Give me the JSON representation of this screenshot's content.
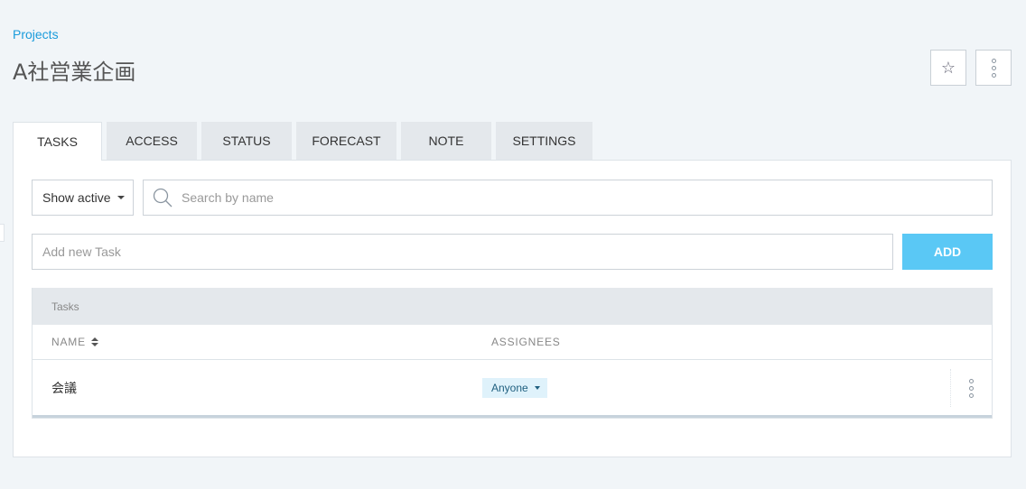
{
  "breadcrumb": {
    "label": "Projects"
  },
  "page": {
    "title": "A社営業企画"
  },
  "header_actions": {
    "star_icon": "star-icon",
    "more_icon": "more-vertical-icon"
  },
  "tabs": [
    {
      "label": "TASKS",
      "active": true
    },
    {
      "label": "ACCESS",
      "active": false
    },
    {
      "label": "STATUS",
      "active": false
    },
    {
      "label": "FORECAST",
      "active": false
    },
    {
      "label": "NOTE",
      "active": false
    },
    {
      "label": "SETTINGS",
      "active": false
    }
  ],
  "filter": {
    "selected": "Show active"
  },
  "search": {
    "placeholder": "Search by name"
  },
  "new_task": {
    "placeholder": "Add new Task",
    "add_label": "ADD"
  },
  "table": {
    "caption": "Tasks",
    "columns": {
      "name": "NAME",
      "assignees": "ASSIGNEES"
    },
    "rows": [
      {
        "name": "会議",
        "assignee": "Anyone"
      }
    ]
  },
  "colors": {
    "accent": "#5ac8f5",
    "link": "#1a9bdb",
    "background": "#f1f5f8"
  }
}
